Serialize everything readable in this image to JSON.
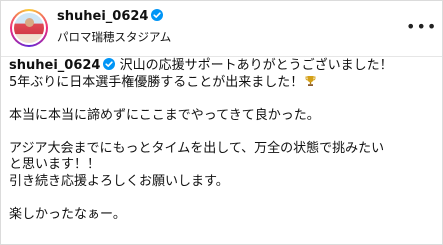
{
  "header": {
    "username": "shuhei_0624",
    "location": "パロマ瑞穂スタジアム",
    "more_label": "•••"
  },
  "caption": {
    "username": "shuhei_0624",
    "lines": [
      "沢山の応援サポートありがとうございました！",
      "5年ぶりに日本選手権優勝することが出来ました！",
      "",
      "本当に本当に諦めずにここまでやってきて良かった。",
      "",
      "アジア大会までにもっとタイムを出して、万全の状態で挑みたい",
      "と思います！！",
      "引き続き応援よろしくお願いします。",
      "",
      "楽しかったなぁー。"
    ]
  },
  "colors": {
    "verified": "#0095f6",
    "text": "#111111",
    "border": "#dbdbdb"
  },
  "icons": {
    "verified": "verified-badge-icon",
    "trophy": "trophy-icon",
    "more": "more-options-icon"
  }
}
